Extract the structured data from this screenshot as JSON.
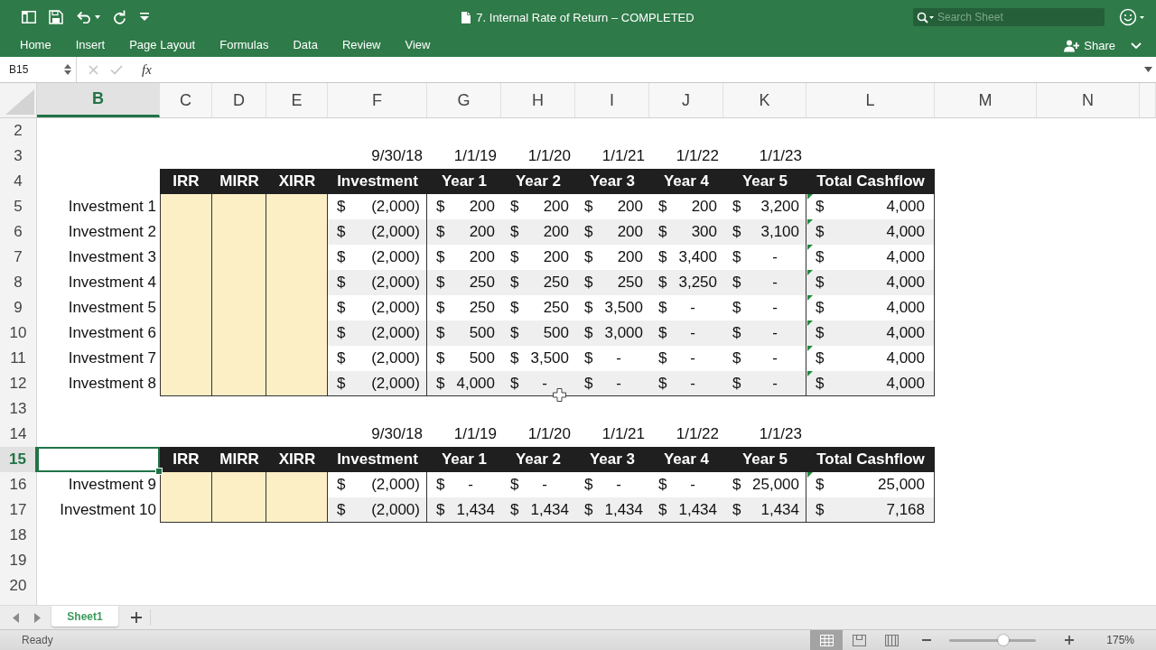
{
  "window": {
    "title": "7. Internal Rate of Return – COMPLETED"
  },
  "search": {
    "placeholder": "Search Sheet"
  },
  "ribbon_tabs": [
    {
      "label": "Home",
      "selected": false
    },
    {
      "label": "Insert",
      "selected": false
    },
    {
      "label": "Page Layout",
      "selected": false
    },
    {
      "label": "Formulas",
      "selected": false
    },
    {
      "label": "Data",
      "selected": false
    },
    {
      "label": "Review",
      "selected": false
    },
    {
      "label": "View",
      "selected": false
    }
  ],
  "share": {
    "label": "Share"
  },
  "formula_bar": {
    "name_box": "B15",
    "function_label": "fx",
    "edit_disabled": true
  },
  "columns": [
    {
      "label": "B",
      "selected": true
    },
    {
      "label": "C",
      "selected": false
    },
    {
      "label": "D",
      "selected": false
    },
    {
      "label": "E",
      "selected": false
    },
    {
      "label": "F",
      "selected": false
    },
    {
      "label": "G",
      "selected": false
    },
    {
      "label": "H",
      "selected": false
    },
    {
      "label": "I",
      "selected": false
    },
    {
      "label": "J",
      "selected": false
    },
    {
      "label": "K",
      "selected": false
    },
    {
      "label": "L",
      "selected": false
    },
    {
      "label": "M",
      "selected": false
    },
    {
      "label": "N",
      "selected": false
    }
  ],
  "sheet": {
    "rows": [
      {
        "number": "2",
        "selected": false,
        "kind": "blank"
      },
      {
        "number": "3",
        "selected": false,
        "kind": "dates",
        "dates": [
          "9/30/18",
          "1/1/19",
          "1/1/20",
          "1/1/21",
          "1/1/22",
          "1/1/23"
        ]
      },
      {
        "number": "4",
        "selected": false,
        "kind": "header",
        "headers": [
          "IRR",
          "MIRR",
          "XIRR",
          "Investment",
          "Year 1",
          "Year 2",
          "Year 3",
          "Year 4",
          "Year 5",
          "Total Cashflow"
        ]
      },
      {
        "number": "5",
        "selected": false,
        "kind": "data",
        "label": "Investment 1",
        "values": [
          {
            "symbol": "$",
            "amount": "(2,000)",
            "kind": "number"
          },
          {
            "symbol": "$",
            "amount": "200",
            "kind": "number"
          },
          {
            "symbol": "$",
            "amount": "200",
            "kind": "number"
          },
          {
            "symbol": "$",
            "amount": "200",
            "kind": "number"
          },
          {
            "symbol": "$",
            "amount": "200",
            "kind": "number"
          },
          {
            "symbol": "$",
            "amount": "3,200",
            "kind": "number"
          }
        ],
        "total": {
          "symbol": "$",
          "amount": "4,000",
          "flagged": true
        }
      },
      {
        "number": "6",
        "selected": false,
        "kind": "data",
        "label": "Investment 2",
        "values": [
          {
            "symbol": "$",
            "amount": "(2,000)",
            "kind": "number"
          },
          {
            "symbol": "$",
            "amount": "200",
            "kind": "number"
          },
          {
            "symbol": "$",
            "amount": "200",
            "kind": "number"
          },
          {
            "symbol": "$",
            "amount": "200",
            "kind": "number"
          },
          {
            "symbol": "$",
            "amount": "300",
            "kind": "number"
          },
          {
            "symbol": "$",
            "amount": "3,100",
            "kind": "number"
          }
        ],
        "total": {
          "symbol": "$",
          "amount": "4,000",
          "flagged": true
        }
      },
      {
        "number": "7",
        "selected": false,
        "kind": "data",
        "label": "Investment 3",
        "values": [
          {
            "symbol": "$",
            "amount": "(2,000)",
            "kind": "number"
          },
          {
            "symbol": "$",
            "amount": "200",
            "kind": "number"
          },
          {
            "symbol": "$",
            "amount": "200",
            "kind": "number"
          },
          {
            "symbol": "$",
            "amount": "200",
            "kind": "number"
          },
          {
            "symbol": "$",
            "amount": "3,400",
            "kind": "number"
          },
          {
            "symbol": "$",
            "amount": "-",
            "kind": "dash"
          }
        ],
        "total": {
          "symbol": "$",
          "amount": "4,000",
          "flagged": true
        }
      },
      {
        "number": "8",
        "selected": false,
        "kind": "data",
        "label": "Investment 4",
        "values": [
          {
            "symbol": "$",
            "amount": "(2,000)",
            "kind": "number"
          },
          {
            "symbol": "$",
            "amount": "250",
            "kind": "number"
          },
          {
            "symbol": "$",
            "amount": "250",
            "kind": "number"
          },
          {
            "symbol": "$",
            "amount": "250",
            "kind": "number"
          },
          {
            "symbol": "$",
            "amount": "3,250",
            "kind": "number"
          },
          {
            "symbol": "$",
            "amount": "-",
            "kind": "dash"
          }
        ],
        "total": {
          "symbol": "$",
          "amount": "4,000",
          "flagged": true
        }
      },
      {
        "number": "9",
        "selected": false,
        "kind": "data",
        "label": "Investment 5",
        "values": [
          {
            "symbol": "$",
            "amount": "(2,000)",
            "kind": "number"
          },
          {
            "symbol": "$",
            "amount": "250",
            "kind": "number"
          },
          {
            "symbol": "$",
            "amount": "250",
            "kind": "number"
          },
          {
            "symbol": "$",
            "amount": "3,500",
            "kind": "number"
          },
          {
            "symbol": "$",
            "amount": "-",
            "kind": "dash"
          },
          {
            "symbol": "$",
            "amount": "-",
            "kind": "dash"
          }
        ],
        "total": {
          "symbol": "$",
          "amount": "4,000",
          "flagged": true
        }
      },
      {
        "number": "10",
        "selected": false,
        "kind": "data",
        "label": "Investment 6",
        "values": [
          {
            "symbol": "$",
            "amount": "(2,000)",
            "kind": "number"
          },
          {
            "symbol": "$",
            "amount": "500",
            "kind": "number"
          },
          {
            "symbol": "$",
            "amount": "500",
            "kind": "number"
          },
          {
            "symbol": "$",
            "amount": "3,000",
            "kind": "number"
          },
          {
            "symbol": "$",
            "amount": "-",
            "kind": "dash"
          },
          {
            "symbol": "$",
            "amount": "-",
            "kind": "dash"
          }
        ],
        "total": {
          "symbol": "$",
          "amount": "4,000",
          "flagged": true
        }
      },
      {
        "number": "11",
        "selected": false,
        "kind": "data",
        "label": "Investment 7",
        "values": [
          {
            "symbol": "$",
            "amount": "(2,000)",
            "kind": "number"
          },
          {
            "symbol": "$",
            "amount": "500",
            "kind": "number"
          },
          {
            "symbol": "$",
            "amount": "3,500",
            "kind": "number"
          },
          {
            "symbol": "$",
            "amount": "-",
            "kind": "dash"
          },
          {
            "symbol": "$",
            "amount": "-",
            "kind": "dash"
          },
          {
            "symbol": "$",
            "amount": "-",
            "kind": "dash"
          }
        ],
        "total": {
          "symbol": "$",
          "amount": "4,000",
          "flagged": true
        }
      },
      {
        "number": "12",
        "selected": false,
        "kind": "data",
        "label": "Investment 8",
        "values": [
          {
            "symbol": "$",
            "amount": "(2,000)",
            "kind": "number"
          },
          {
            "symbol": "$",
            "amount": "4,000",
            "kind": "number"
          },
          {
            "symbol": "$",
            "amount": "-",
            "kind": "dash"
          },
          {
            "symbol": "$",
            "amount": "-",
            "kind": "dash"
          },
          {
            "symbol": "$",
            "amount": "-",
            "kind": "dash"
          },
          {
            "symbol": "$",
            "amount": "-",
            "kind": "dash"
          }
        ],
        "total": {
          "symbol": "$",
          "amount": "4,000",
          "flagged": true
        }
      },
      {
        "number": "13",
        "selected": false,
        "kind": "blank"
      },
      {
        "number": "14",
        "selected": false,
        "kind": "dates",
        "dates": [
          "9/30/18",
          "1/1/19",
          "1/1/20",
          "1/1/21",
          "1/1/22",
          "1/1/23"
        ]
      },
      {
        "number": "15",
        "selected": true,
        "kind": "header",
        "headers": [
          "IRR",
          "MIRR",
          "XIRR",
          "Investment",
          "Year 1",
          "Year 2",
          "Year 3",
          "Year 4",
          "Year 5",
          "Total Cashflow"
        ]
      },
      {
        "number": "16",
        "selected": false,
        "kind": "data",
        "label": "Investment 9",
        "values": [
          {
            "symbol": "$",
            "amount": "(2,000)",
            "kind": "number"
          },
          {
            "symbol": "$",
            "amount": "-",
            "kind": "dash"
          },
          {
            "symbol": "$",
            "amount": "-",
            "kind": "dash"
          },
          {
            "symbol": "$",
            "amount": "-",
            "kind": "dash"
          },
          {
            "symbol": "$",
            "amount": "-",
            "kind": "dash"
          },
          {
            "symbol": "$",
            "amount": "25,000",
            "kind": "number"
          }
        ],
        "total": {
          "symbol": "$",
          "amount": "25,000",
          "flagged": true
        }
      },
      {
        "number": "17",
        "selected": false,
        "kind": "data",
        "label": "Investment 10",
        "values": [
          {
            "symbol": "$",
            "amount": "(2,000)",
            "kind": "number"
          },
          {
            "symbol": "$",
            "amount": "1,434",
            "kind": "number"
          },
          {
            "symbol": "$",
            "amount": "1,434",
            "kind": "number"
          },
          {
            "symbol": "$",
            "amount": "1,434",
            "kind": "number"
          },
          {
            "symbol": "$",
            "amount": "1,434",
            "kind": "number"
          },
          {
            "symbol": "$",
            "amount": "1,434",
            "kind": "number"
          }
        ],
        "total": {
          "symbol": "$",
          "amount": "7,168",
          "flagged": false
        }
      },
      {
        "number": "18",
        "selected": false,
        "kind": "blank"
      },
      {
        "number": "19",
        "selected": false,
        "kind": "blank"
      },
      {
        "number": "20",
        "selected": false,
        "kind": "blank"
      }
    ]
  },
  "sheet_tabs": [
    {
      "label": "Sheet1",
      "selected": true
    }
  ],
  "status_bar": {
    "status": "Ready",
    "view_buttons": [
      {
        "kind": "normal",
        "selected": true
      },
      {
        "kind": "page_layout",
        "selected": false
      },
      {
        "kind": "page_break",
        "selected": false
      }
    ],
    "zoom_slider": {
      "level": 0.62
    },
    "zoom": "175%"
  }
}
